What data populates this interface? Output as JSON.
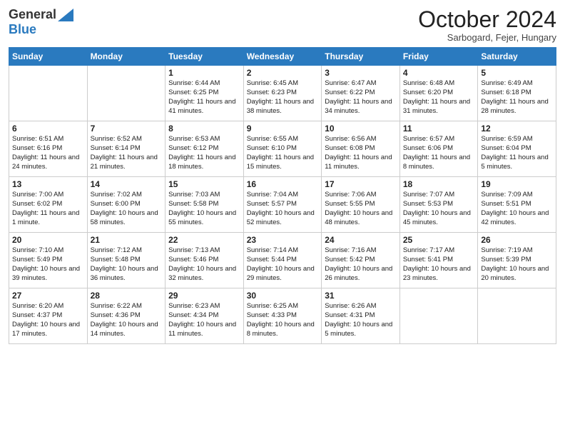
{
  "header": {
    "logo_general": "General",
    "logo_blue": "Blue",
    "month_title": "October 2024",
    "subtitle": "Sarbogard, Fejer, Hungary"
  },
  "days_of_week": [
    "Sunday",
    "Monday",
    "Tuesday",
    "Wednesday",
    "Thursday",
    "Friday",
    "Saturday"
  ],
  "weeks": [
    [
      {
        "day": "",
        "info": ""
      },
      {
        "day": "",
        "info": ""
      },
      {
        "day": "1",
        "info": "Sunrise: 6:44 AM\nSunset: 6:25 PM\nDaylight: 11 hours and 41 minutes."
      },
      {
        "day": "2",
        "info": "Sunrise: 6:45 AM\nSunset: 6:23 PM\nDaylight: 11 hours and 38 minutes."
      },
      {
        "day": "3",
        "info": "Sunrise: 6:47 AM\nSunset: 6:22 PM\nDaylight: 11 hours and 34 minutes."
      },
      {
        "day": "4",
        "info": "Sunrise: 6:48 AM\nSunset: 6:20 PM\nDaylight: 11 hours and 31 minutes."
      },
      {
        "day": "5",
        "info": "Sunrise: 6:49 AM\nSunset: 6:18 PM\nDaylight: 11 hours and 28 minutes."
      }
    ],
    [
      {
        "day": "6",
        "info": "Sunrise: 6:51 AM\nSunset: 6:16 PM\nDaylight: 11 hours and 24 minutes."
      },
      {
        "day": "7",
        "info": "Sunrise: 6:52 AM\nSunset: 6:14 PM\nDaylight: 11 hours and 21 minutes."
      },
      {
        "day": "8",
        "info": "Sunrise: 6:53 AM\nSunset: 6:12 PM\nDaylight: 11 hours and 18 minutes."
      },
      {
        "day": "9",
        "info": "Sunrise: 6:55 AM\nSunset: 6:10 PM\nDaylight: 11 hours and 15 minutes."
      },
      {
        "day": "10",
        "info": "Sunrise: 6:56 AM\nSunset: 6:08 PM\nDaylight: 11 hours and 11 minutes."
      },
      {
        "day": "11",
        "info": "Sunrise: 6:57 AM\nSunset: 6:06 PM\nDaylight: 11 hours and 8 minutes."
      },
      {
        "day": "12",
        "info": "Sunrise: 6:59 AM\nSunset: 6:04 PM\nDaylight: 11 hours and 5 minutes."
      }
    ],
    [
      {
        "day": "13",
        "info": "Sunrise: 7:00 AM\nSunset: 6:02 PM\nDaylight: 11 hours and 1 minute."
      },
      {
        "day": "14",
        "info": "Sunrise: 7:02 AM\nSunset: 6:00 PM\nDaylight: 10 hours and 58 minutes."
      },
      {
        "day": "15",
        "info": "Sunrise: 7:03 AM\nSunset: 5:58 PM\nDaylight: 10 hours and 55 minutes."
      },
      {
        "day": "16",
        "info": "Sunrise: 7:04 AM\nSunset: 5:57 PM\nDaylight: 10 hours and 52 minutes."
      },
      {
        "day": "17",
        "info": "Sunrise: 7:06 AM\nSunset: 5:55 PM\nDaylight: 10 hours and 48 minutes."
      },
      {
        "day": "18",
        "info": "Sunrise: 7:07 AM\nSunset: 5:53 PM\nDaylight: 10 hours and 45 minutes."
      },
      {
        "day": "19",
        "info": "Sunrise: 7:09 AM\nSunset: 5:51 PM\nDaylight: 10 hours and 42 minutes."
      }
    ],
    [
      {
        "day": "20",
        "info": "Sunrise: 7:10 AM\nSunset: 5:49 PM\nDaylight: 10 hours and 39 minutes."
      },
      {
        "day": "21",
        "info": "Sunrise: 7:12 AM\nSunset: 5:48 PM\nDaylight: 10 hours and 36 minutes."
      },
      {
        "day": "22",
        "info": "Sunrise: 7:13 AM\nSunset: 5:46 PM\nDaylight: 10 hours and 32 minutes."
      },
      {
        "day": "23",
        "info": "Sunrise: 7:14 AM\nSunset: 5:44 PM\nDaylight: 10 hours and 29 minutes."
      },
      {
        "day": "24",
        "info": "Sunrise: 7:16 AM\nSunset: 5:42 PM\nDaylight: 10 hours and 26 minutes."
      },
      {
        "day": "25",
        "info": "Sunrise: 7:17 AM\nSunset: 5:41 PM\nDaylight: 10 hours and 23 minutes."
      },
      {
        "day": "26",
        "info": "Sunrise: 7:19 AM\nSunset: 5:39 PM\nDaylight: 10 hours and 20 minutes."
      }
    ],
    [
      {
        "day": "27",
        "info": "Sunrise: 6:20 AM\nSunset: 4:37 PM\nDaylight: 10 hours and 17 minutes."
      },
      {
        "day": "28",
        "info": "Sunrise: 6:22 AM\nSunset: 4:36 PM\nDaylight: 10 hours and 14 minutes."
      },
      {
        "day": "29",
        "info": "Sunrise: 6:23 AM\nSunset: 4:34 PM\nDaylight: 10 hours and 11 minutes."
      },
      {
        "day": "30",
        "info": "Sunrise: 6:25 AM\nSunset: 4:33 PM\nDaylight: 10 hours and 8 minutes."
      },
      {
        "day": "31",
        "info": "Sunrise: 6:26 AM\nSunset: 4:31 PM\nDaylight: 10 hours and 5 minutes."
      },
      {
        "day": "",
        "info": ""
      },
      {
        "day": "",
        "info": ""
      }
    ]
  ]
}
